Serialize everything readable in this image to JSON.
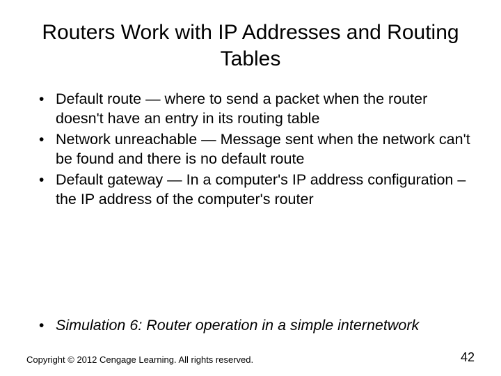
{
  "title": "Routers Work with IP Addresses and Routing Tables",
  "bullets": [
    "Default route — where to send a packet when the router doesn't have an entry in its routing table",
    "Network unreachable — Message sent when the network can't be found and there is no default route",
    "Default gateway — In a computer's IP address configuration – the IP address of the computer's router"
  ],
  "simulation": "Simulation 6: Router operation in a simple internetwork",
  "copyright": "Copyright © 2012 Cengage Learning. All rights reserved.",
  "page": "42"
}
